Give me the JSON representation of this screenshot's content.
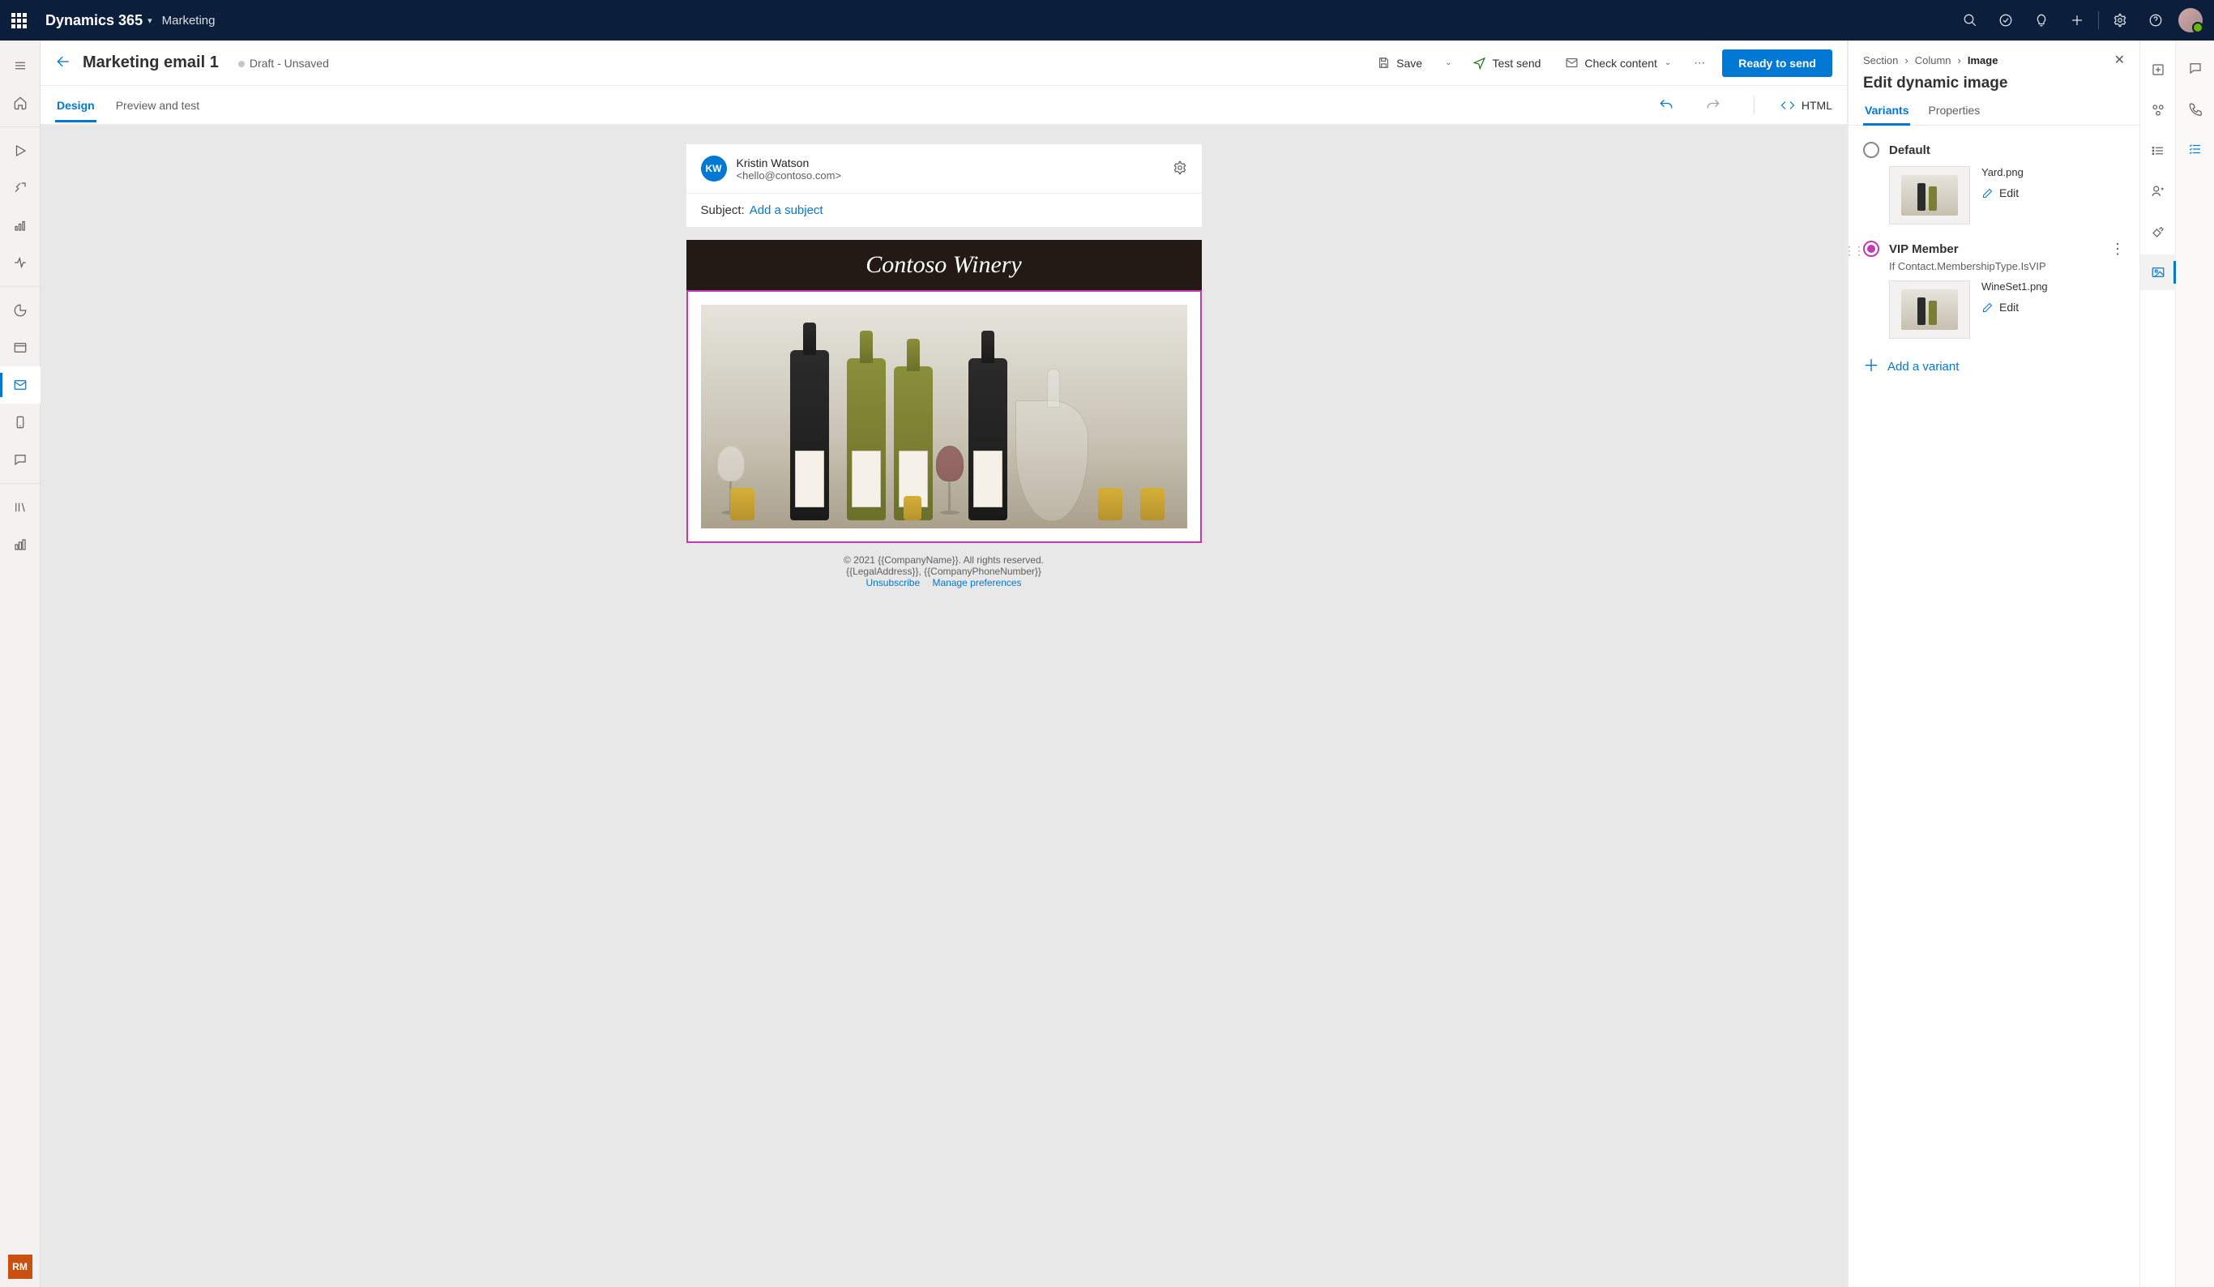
{
  "topbar": {
    "brand": "Dynamics 365",
    "area": "Marketing"
  },
  "page": {
    "title": "Marketing email 1",
    "status": "Draft - Unsaved"
  },
  "commands": {
    "save": "Save",
    "testsend": "Test send",
    "checkcontent": "Check content",
    "primary": "Ready to send"
  },
  "tabs": {
    "design": "Design",
    "preview": "Preview and test",
    "html": "HTML"
  },
  "emailhead": {
    "initials": "KW",
    "name": "Kristin Watson",
    "addr": "<hello@contoso.com>",
    "subject_label": "Subject:",
    "subject_link": "Add a subject"
  },
  "emailbody": {
    "banner": "Contoso Winery",
    "footer1": "© 2021 {{CompanyName}}. All rights reserved.",
    "footer2": "{{LegalAddress}}, {{CompanyPhoneNumber}}",
    "unsub": "Unsubscribe",
    "manage": "Manage preferences"
  },
  "panel": {
    "crumb1": "Section",
    "crumb2": "Column",
    "crumb3": "Image",
    "title": "Edit dynamic image",
    "tab_variants": "Variants",
    "tab_props": "Properties",
    "variants": [
      {
        "name": "Default",
        "condition": "",
        "file": "Yard.png",
        "edit": "Edit",
        "selected": false
      },
      {
        "name": "VIP Member",
        "condition": "If Contact.MembershipType.IsVIP",
        "file": "WineSet1.png",
        "edit": "Edit",
        "selected": true
      }
    ],
    "add": "Add a variant"
  },
  "leftrail_badge": "RM"
}
